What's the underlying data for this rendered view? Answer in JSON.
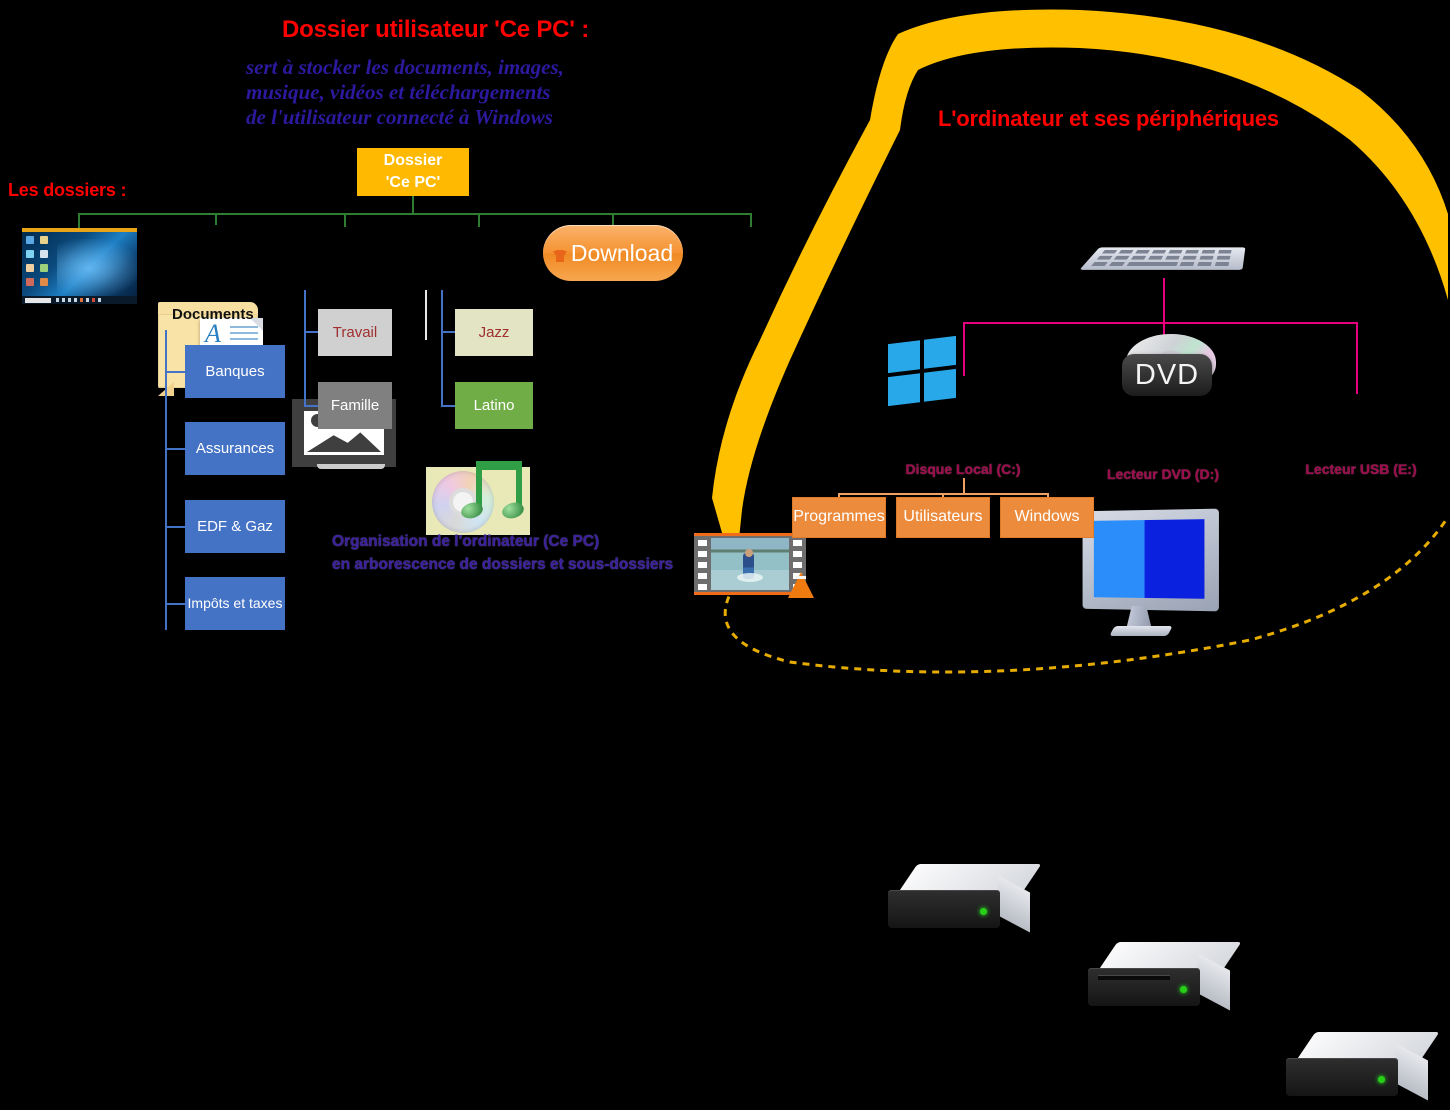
{
  "headings": {
    "left_title": "Dossier utilisateur 'Ce PC' :",
    "left_subtitle_l1": "sert à stocker les documents, images,",
    "left_subtitle_l2": "musique, vidéos et téléchargements",
    "left_subtitle_l3": "de l'utilisateur connecté à Windows",
    "folders_label": "Les dossiers :",
    "right_title": "L'ordinateur et ses périphériques",
    "note_l1": "Organisation de l'ordinateur (Ce PC)",
    "note_l2": "en arborescence de dossiers et sous-dossiers"
  },
  "root_box": {
    "line1": "Dossier",
    "line2": "'Ce PC'"
  },
  "tree_nodes": [
    {
      "name": "desktop-thumbnail",
      "label": ""
    },
    {
      "name": "documents-folder",
      "label": "Documents"
    },
    {
      "name": "pictures-icon",
      "label": ""
    },
    {
      "name": "music-icon",
      "label": ""
    },
    {
      "name": "download-button",
      "label": "Download"
    },
    {
      "name": "videos-thumbnail",
      "label": ""
    }
  ],
  "documents_children": [
    {
      "label": "Banques"
    },
    {
      "label": "Assurances"
    },
    {
      "label": "EDF & Gaz"
    },
    {
      "label": "Impôts et taxes"
    }
  ],
  "pictures_children": [
    {
      "label": "Travail"
    },
    {
      "label": "Famille"
    }
  ],
  "music_children": [
    {
      "label": "Jazz"
    },
    {
      "label": "Latino"
    }
  ],
  "drives": [
    {
      "label": "Disque Local (C:)"
    },
    {
      "label": "Lecteur DVD (D:)"
    },
    {
      "label": "Lecteur USB (E:)"
    }
  ],
  "dvd_badge_text": "DVD",
  "disk_c_children": [
    {
      "label": "Programmes"
    },
    {
      "label": "Utilisateurs"
    },
    {
      "label": "Windows"
    }
  ],
  "colors": {
    "background": "#000000",
    "title_red": "#ff0000",
    "subtitle_blue": "#2b1a9e",
    "root_box_yellow": "#ffb900",
    "folder_box_blue": "#4472c4",
    "green_box": "#70ad47",
    "cream_box": "#e2e4c4",
    "grey_box": "#808080",
    "light_grey_box": "#d0d0d0",
    "orange_box": "#ed8b3c",
    "drive_label_magenta": "#9c0b4b",
    "connector_green": "#2e7d32",
    "connector_blue": "#4472c4",
    "connector_pink": "#e6007e",
    "arc_yellow": "#ffc000"
  }
}
